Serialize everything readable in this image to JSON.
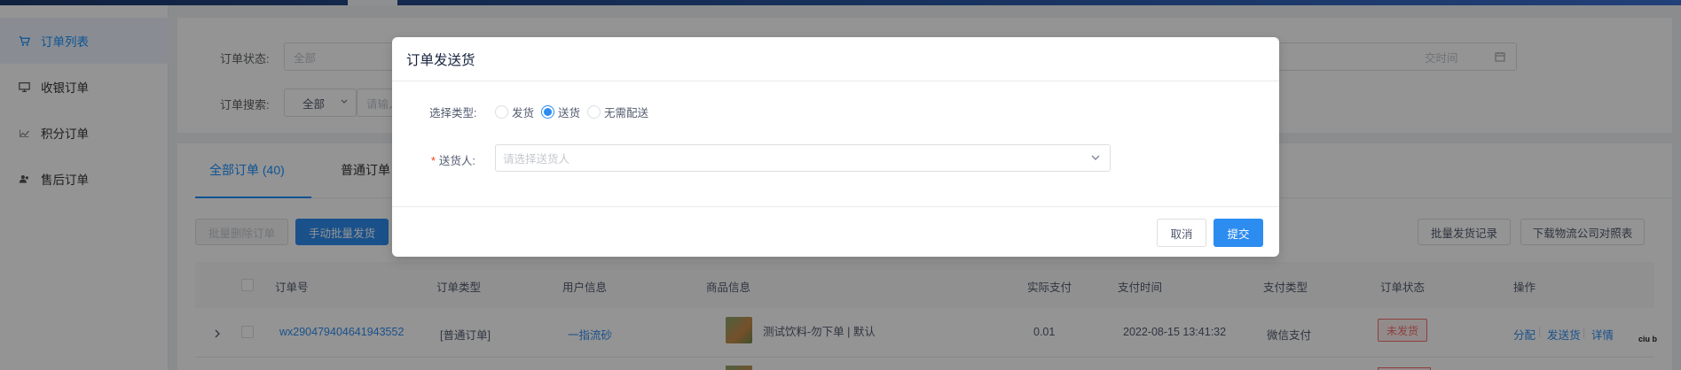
{
  "sidebar": {
    "items": [
      {
        "label": "订单列表",
        "icon": "cart-icon",
        "active": true
      },
      {
        "label": "收银订单",
        "icon": "monitor-icon",
        "active": false
      },
      {
        "label": "积分订单",
        "icon": "points-icon",
        "active": false
      },
      {
        "label": "售后订单",
        "icon": "users-icon",
        "active": false
      }
    ]
  },
  "filters": {
    "status_label": "订单状态:",
    "status_value": "全部",
    "time_placeholder": "交时间",
    "search_label": "订单搜索:",
    "search_type": "全部",
    "search_placeholder": "请输入"
  },
  "tabs": [
    "全部订单 (40)",
    "普通订单"
  ],
  "toolbar": {
    "batch_delete": "批量删除订单",
    "manual_batch_ship": "手动批量发货",
    "batch_ship_log": "批量发货记录",
    "download_logistics": "下载物流公司对照表"
  },
  "table": {
    "headers": [
      "订单号",
      "订单类型",
      "用户信息",
      "商品信息",
      "实际支付",
      "支付时间",
      "支付类型",
      "订单状态",
      "操作"
    ],
    "rows": [
      {
        "order_no": "wx290479404641943552",
        "type": "[普通订单]",
        "user": "一指流砂",
        "product": "测试饮料-勿下单 | 默认",
        "paid": "0.01",
        "pay_time": "2022-08-15 13:41:32",
        "pay_type": "微信支付",
        "status": "未发货",
        "actions": [
          "分配",
          "发送货",
          "详情"
        ]
      }
    ]
  },
  "modal": {
    "title": "订单发送货",
    "type_label": "选择类型:",
    "options": [
      {
        "label": "发货",
        "checked": false
      },
      {
        "label": "送货",
        "checked": true
      },
      {
        "label": "无需配送",
        "checked": false
      }
    ],
    "courier_required": "*",
    "courier_label": "送货人:",
    "courier_placeholder": "请选择送货人",
    "cancel": "取消",
    "submit": "提交"
  },
  "corner_text": "ciu b"
}
